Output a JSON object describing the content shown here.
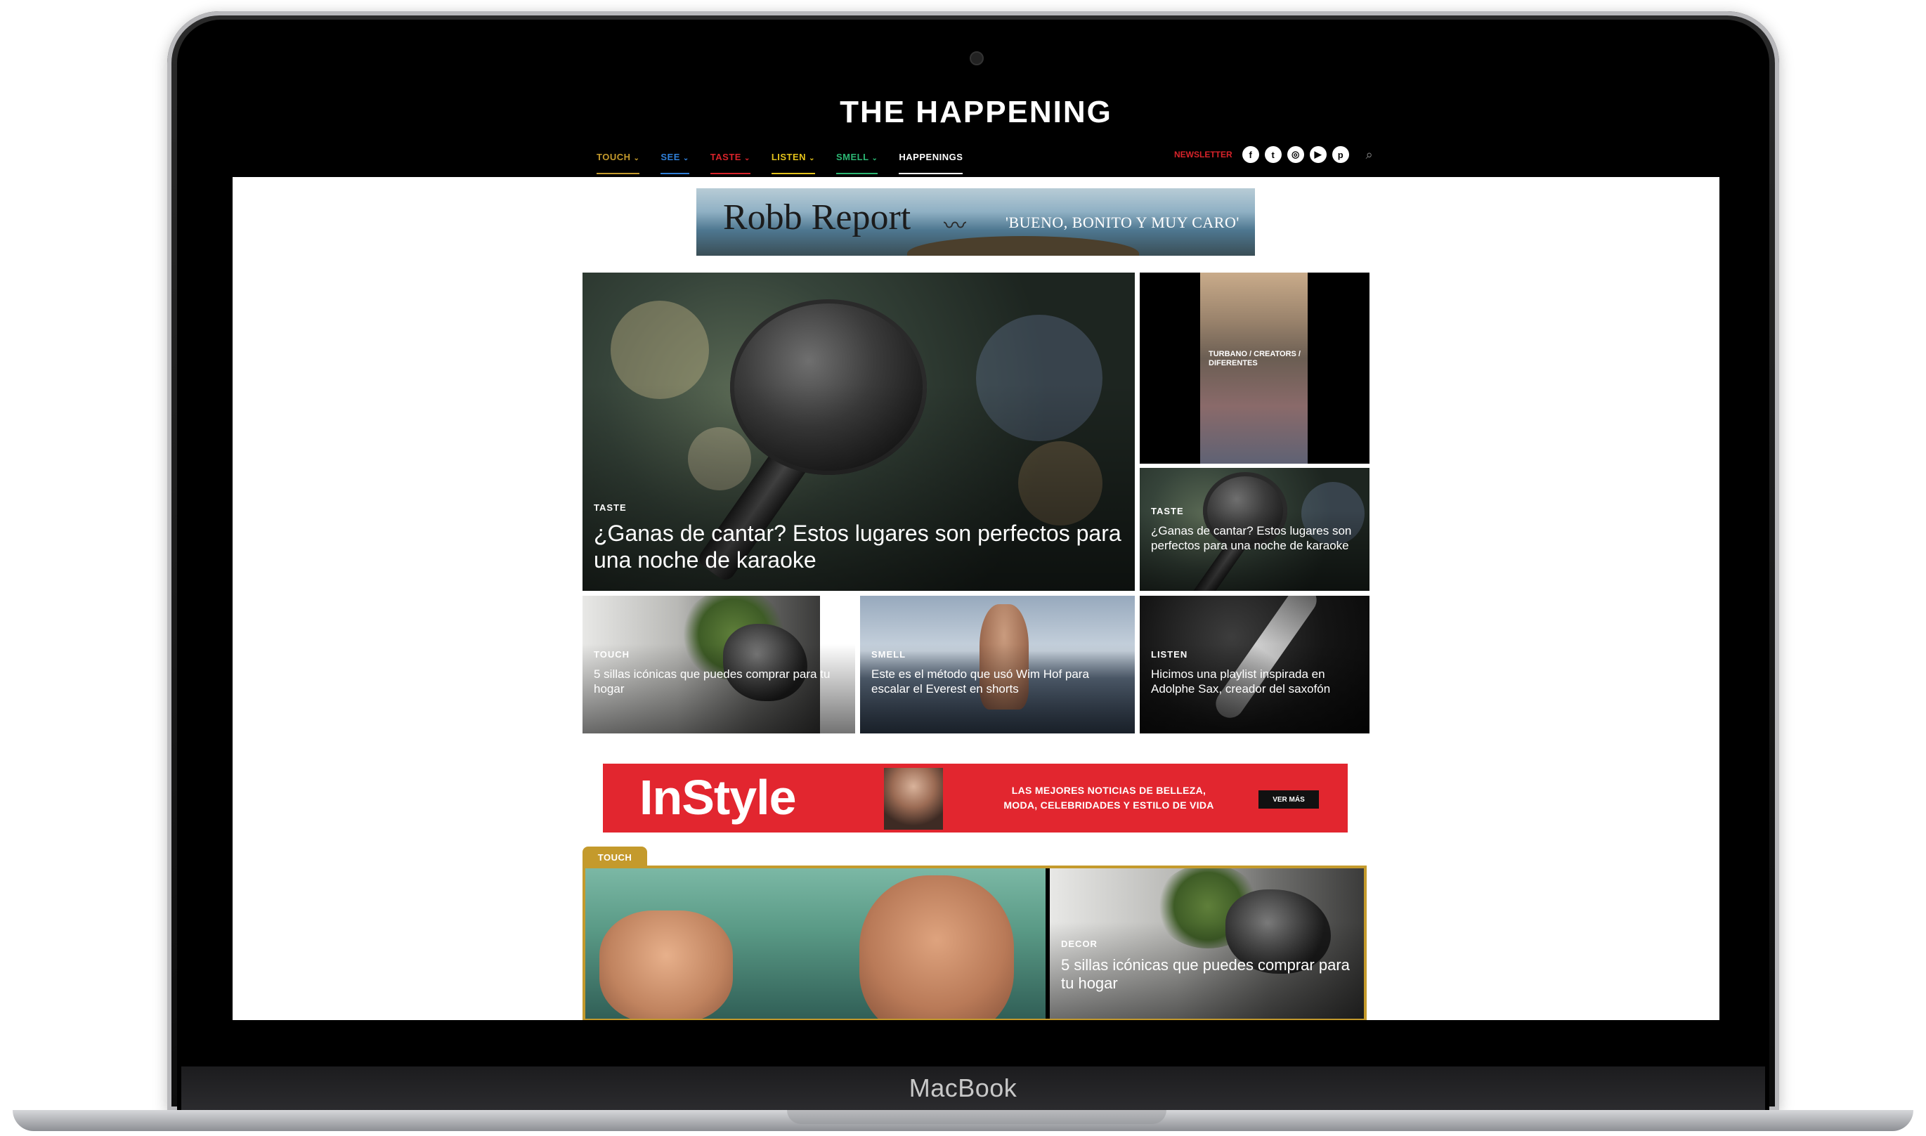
{
  "device": {
    "brand": "MacBook"
  },
  "site": {
    "logo": "THE HAPPENING",
    "nav": [
      {
        "label": "TOUCH",
        "color": "#c49a2c",
        "has_menu": true
      },
      {
        "label": "SEE",
        "color": "#2f7fd8",
        "has_menu": true
      },
      {
        "label": "TASTE",
        "color": "#d8232a",
        "has_menu": true
      },
      {
        "label": "LISTEN",
        "color": "#e3c21b",
        "has_menu": true
      },
      {
        "label": "SMELL",
        "color": "#2bb673",
        "has_menu": true
      },
      {
        "label": "HAPPENINGS",
        "color": "#ffffff",
        "has_menu": false
      }
    ],
    "newsletter_label": "NEWSLETTER",
    "social_icons": [
      "facebook-icon",
      "twitter-icon",
      "instagram-icon",
      "youtube-icon",
      "pinterest-icon"
    ],
    "social_glyphs": [
      "f",
      "t",
      "◎",
      "▶",
      "p"
    ],
    "search_icon": "search-icon"
  },
  "ads": {
    "robb_report": {
      "brand": "Robb Report",
      "tagline": "'BUENO, BONITO Y MUY CARO'"
    },
    "instyle": {
      "brand": "InStyle",
      "copy_line1": "LAS MEJORES NOTICIAS DE BELLEZA,",
      "copy_line2": "MODA, CELEBRIDADES Y ESTILO DE VIDA",
      "button": "VER MÁS"
    }
  },
  "articles": {
    "hero": {
      "category": "TASTE",
      "title": "¿Ganas de cantar? Estos lugares son perfectos para una noche de karaoke"
    },
    "side_top": {
      "overlay": "TURBANO / CREATORS / DIFERENTES"
    },
    "side_bottom": {
      "category": "TASTE",
      "title": "¿Ganas de cantar? Estos lugares son perfectos para una noche de karaoke"
    },
    "row": [
      {
        "category": "TOUCH",
        "title": "5 sillas icónicas que puedes comprar para tu hogar"
      },
      {
        "category": "SMELL",
        "title": "Este es el método que usó Wim Hof para escalar el Everest en shorts"
      },
      {
        "category": "LISTEN",
        "title": "Hicimos una playlist inspirada en Adolphe Sax, creador del saxofón"
      }
    ]
  },
  "touch_section": {
    "tab": "TOUCH",
    "feature": {
      "category": "DECOR",
      "title": "5 sillas icónicas que puedes comprar para tu hogar"
    }
  }
}
